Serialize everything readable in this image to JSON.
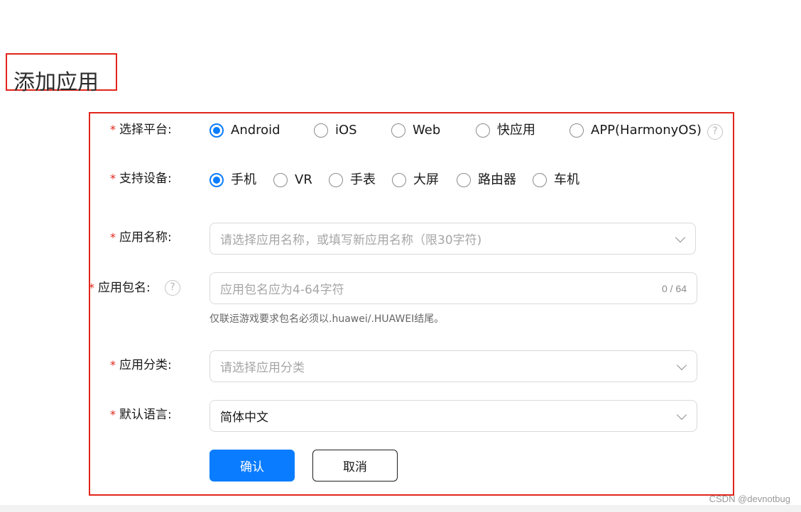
{
  "page": {
    "title": "添加应用"
  },
  "form": {
    "platform": {
      "label": "选择平台:",
      "options": [
        "Android",
        "iOS",
        "Web",
        "快应用",
        "APP(HarmonyOS)"
      ],
      "selected": "Android",
      "help_icon": "question-circle-icon"
    },
    "device": {
      "label": "支持设备:",
      "options": [
        "手机",
        "VR",
        "手表",
        "大屏",
        "路由器",
        "车机"
      ],
      "selected": "手机"
    },
    "app_name": {
      "label": "应用名称:",
      "placeholder": "请选择应用名称，或填写新应用名称（限30字符)",
      "icon": "chevron-down-icon"
    },
    "package_name": {
      "label": "应用包名:",
      "placeholder": "应用包名应为4-64字符",
      "counter": "0 / 64",
      "hint": "仅联运游戏要求包名必须以.huawei/.HUAWEI结尾。",
      "help_icon": "question-circle-icon"
    },
    "category": {
      "label": "应用分类:",
      "placeholder": "请选择应用分类",
      "icon": "chevron-down-icon"
    },
    "language": {
      "label": "默认语言:",
      "value": "简体中文",
      "icon": "chevron-down-icon"
    },
    "required_mark": "*"
  },
  "actions": {
    "confirm": "确认",
    "cancel": "取消"
  },
  "watermark": "CSDN @devnotbug",
  "colors": {
    "accent": "#0a7cff",
    "required": "#e1251b",
    "annotation": "#e1251b"
  }
}
